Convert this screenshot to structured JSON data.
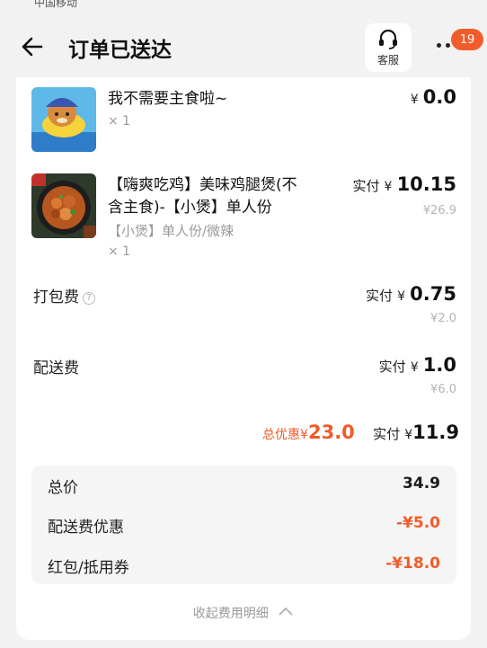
{
  "status_bar": {
    "carrier": "中国移动"
  },
  "header": {
    "title": "订单已送达",
    "service_label": "客服",
    "badge_count": "19"
  },
  "items": [
    {
      "name": "我不需要主食啦~",
      "spec": "",
      "qty": "× 1",
      "paid_label": "",
      "currency": "¥",
      "paid_amount": "0.0",
      "original_price": ""
    },
    {
      "name_line1": "【嗨爽吃鸡】美味鸡腿煲(不",
      "name_line2": "含主食)-【小煲】单人份",
      "spec": "【小煲】单人份/微辣",
      "qty": "× 1",
      "paid_label": "实付",
      "currency": "¥",
      "paid_amount": "10.15",
      "original_price": "¥26.9"
    }
  ],
  "fees": {
    "packing": {
      "label": "打包费",
      "paid_label": "实付",
      "currency": "¥",
      "paid_amount": "0.75",
      "original_price": "¥2.0"
    },
    "delivery": {
      "label": "配送费",
      "paid_label": "实付",
      "currency": "¥",
      "paid_amount": "1.0",
      "original_price": "¥6.0"
    }
  },
  "summary": {
    "discount_label": "总优惠",
    "discount_currency": "¥",
    "discount_amount": "23.0",
    "paid_label": "实付",
    "paid_currency": "¥",
    "paid_amount": "11.9"
  },
  "details": [
    {
      "label": "总价",
      "value": "34.9"
    },
    {
      "label": "配送费优惠",
      "value": "-¥5.0"
    },
    {
      "label": "红包/抵用券",
      "value": "-¥18.0"
    }
  ],
  "collapse_label": "收起费用明细",
  "colors": {
    "accent": "#f25b2a",
    "muted": "#b4b4b4",
    "card": "#ffffff",
    "background": "#f2f2f2"
  },
  "icons": {
    "back": "arrow-left-icon",
    "service": "headset-icon",
    "more": "more-dots-icon",
    "help": "question-circle-icon",
    "collapse": "chevron-up-icon"
  }
}
